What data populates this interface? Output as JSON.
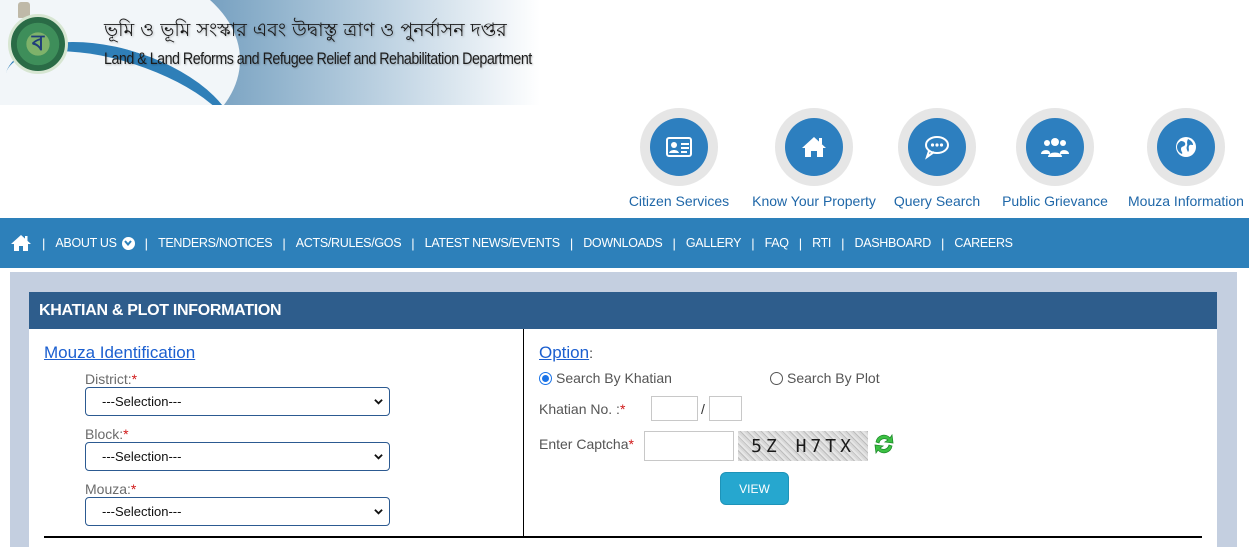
{
  "header": {
    "title_bengali": "ভূমি ও ভূমি সংস্কার এবং উদ্বাস্তু ত্রাণ ও পুনর্বাসন দপ্তর",
    "title_english": "Land & Land Reforms and Refugee Relief and Rehabilitation Department",
    "logo_icon": "state-seal-icon"
  },
  "quick_links": [
    {
      "label": "Citizen Services",
      "icon": "id-card-icon"
    },
    {
      "label": "Know Your Property",
      "icon": "home-icon"
    },
    {
      "label": "Query Search",
      "icon": "chat-bubble-icon"
    },
    {
      "label": "Public Grievance",
      "icon": "users-group-icon"
    },
    {
      "label": "Mouza Information",
      "icon": "globe-icon"
    }
  ],
  "nav": {
    "home_icon": "home-icon",
    "separator": "|",
    "items": [
      {
        "label": "ABOUT US",
        "has_dropdown": true
      },
      {
        "label": "TENDERS/NOTICES"
      },
      {
        "label": "ACTS/RULES/GOS"
      },
      {
        "label": "LATEST NEWS/EVENTS"
      },
      {
        "label": "DOWNLOADS"
      },
      {
        "label": "GALLERY"
      },
      {
        "label": "FAQ"
      },
      {
        "label": "RTI"
      },
      {
        "label": "DASHBOARD"
      },
      {
        "label": "CAREERS"
      }
    ]
  },
  "panel": {
    "title": "KHATIAN & PLOT INFORMATION",
    "left": {
      "section_title": "Mouza Identification",
      "fields": [
        {
          "label": "District:",
          "required": "*",
          "selected": "---Selection---"
        },
        {
          "label": "Block:",
          "required": "*",
          "selected": "---Selection---"
        },
        {
          "label": "Mouza:",
          "required": "*",
          "selected": "---Selection---"
        }
      ]
    },
    "right": {
      "option_title": "Option",
      "option_colon": ":",
      "radios": [
        {
          "label": "Search By Khatian",
          "checked": true
        },
        {
          "label": "Search By Plot",
          "checked": false
        }
      ],
      "khatian_label": "Khatian No. :",
      "khatian_required": "*",
      "khatian_value_1": "",
      "khatian_value_2": "",
      "khatian_separator": "/",
      "captcha_label": "Enter Captcha",
      "captcha_required": "*",
      "captcha_value": "",
      "captcha_text": "5Z H7TX",
      "refresh_icon": "refresh-icon",
      "view_button": "VIEW"
    }
  },
  "colors": {
    "nav_bg": "#2d80ba",
    "panel_header": "#2e5d8c",
    "page_bg_area": "#c4cfe0",
    "link": "#1b5fd0",
    "button": "#26a7cf",
    "required": "#d01818"
  }
}
